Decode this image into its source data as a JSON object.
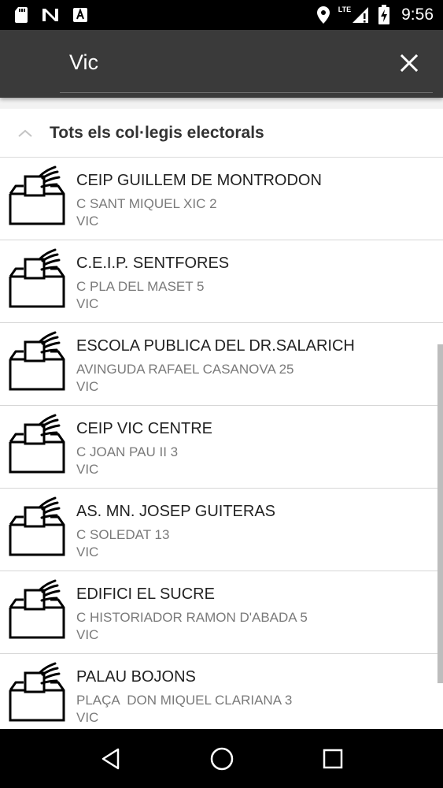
{
  "status_bar": {
    "time": "9:56",
    "network_label": "LTE",
    "icons": [
      "sd-card-icon",
      "n-notification-icon",
      "a-notification-icon",
      "location-icon",
      "signal-icon",
      "battery-charging-icon"
    ]
  },
  "search": {
    "query": "Vic",
    "clear_icon": "close-icon"
  },
  "section": {
    "title": "Tots els col·legis electorals",
    "expanded": true
  },
  "results": [
    {
      "name": "CEIP GUILLEM DE MONTRODON",
      "address": "C SANT MIQUEL XIC 2",
      "city": "VIC"
    },
    {
      "name": "C.E.I.P. SENTFORES",
      "address": "C PLA DEL MASET 5",
      "city": "VIC"
    },
    {
      "name": "ESCOLA PUBLICA DEL DR.SALARICH",
      "address": "AVINGUDA RAFAEL CASANOVA 25",
      "city": "VIC"
    },
    {
      "name": "CEIP VIC CENTRE",
      "address": "C JOAN PAU II 3",
      "city": "VIC"
    },
    {
      "name": "AS. MN. JOSEP GUITERAS",
      "address": "C SOLEDAT 13",
      "city": "VIC"
    },
    {
      "name": "EDIFICI EL SUCRE",
      "address": "C HISTORIADOR RAMON D'ABADA 5",
      "city": "VIC"
    },
    {
      "name": "PALAU BOJONS",
      "address": "PLAÇA  DON MIQUEL CLARIANA 3",
      "city": "VIC"
    }
  ],
  "nav_bar": {
    "buttons": [
      "back-icon",
      "home-icon",
      "recents-icon"
    ]
  },
  "colors": {
    "app_bar": "#3a3a3a",
    "status_bar": "#000000",
    "primary_text": "#222222",
    "secondary_text": "#7a7a7a"
  }
}
